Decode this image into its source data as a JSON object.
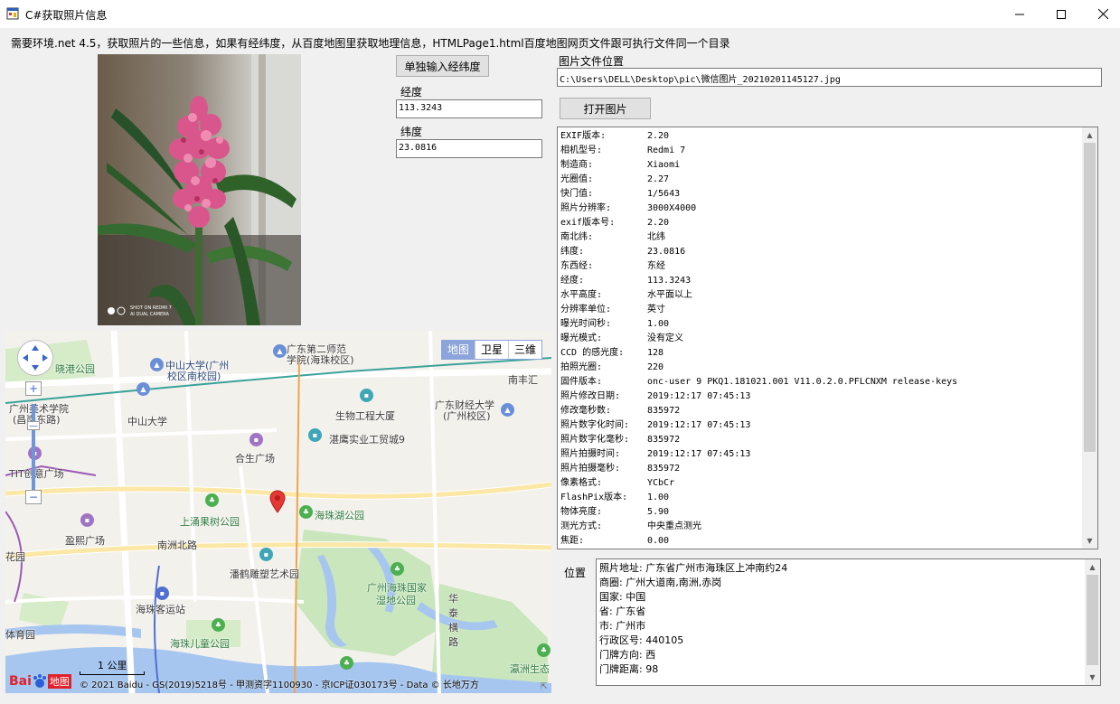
{
  "window": {
    "title": "C#获取照片信息",
    "minimize_label": "—",
    "maximize_label": "☐",
    "close_label": "✕"
  },
  "requirement_text": "需要环境.net 4.5，获取照片的一些信息，如果有经纬度，从百度地图里获取地理信息，HTMLPage1.html百度地图网页文件跟可执行文件同一个目录",
  "photo": {
    "watermark_line1": "SHOT ON REDMI 7",
    "watermark_line2": "AI DUAL CAMERA"
  },
  "manual_input_button": "单独输入经纬度",
  "longitude_label": "经度",
  "longitude_value": "113.3243",
  "latitude_label": "纬度",
  "latitude_value": "23.0816",
  "path_label": "图片文件位置",
  "path_value": "C:\\Users\\DELL\\Desktop\\pic\\微信图片_20210201145127.jpg",
  "open_button": "打开图片",
  "exif": [
    {
      "key": "EXIF版本:",
      "value": "2.20"
    },
    {
      "key": "相机型号:",
      "value": "Redmi 7"
    },
    {
      "key": "制造商:",
      "value": "Xiaomi"
    },
    {
      "key": "光圈值:",
      "value": "2.27"
    },
    {
      "key": "快门值:",
      "value": "1/5643"
    },
    {
      "key": "照片分辨率:",
      "value": "3000X4000"
    },
    {
      "key": "exif版本号:",
      "value": "2.20"
    },
    {
      "key": "南北纬:",
      "value": "北纬"
    },
    {
      "key": "纬度:",
      "value": "23.0816"
    },
    {
      "key": "东西经:",
      "value": "东经"
    },
    {
      "key": "经度:",
      "value": "113.3243"
    },
    {
      "key": "水平高度:",
      "value": "水平面以上"
    },
    {
      "key": "分辨率单位:",
      "value": "英寸"
    },
    {
      "key": "曝光时间秒:",
      "value": "1.00"
    },
    {
      "key": "曝光模式:",
      "value": "没有定义"
    },
    {
      "key": "CCD 的感光度:",
      "value": "128"
    },
    {
      "key": "拍照光圈:",
      "value": "220"
    },
    {
      "key": "固件版本:",
      "value": "onc-user 9 PKQ1.181021.001 V11.0.2.0.PFLCNXM release-keys"
    },
    {
      "key": "照片修改日期:",
      "value": "2019:12:17 07:45:13"
    },
    {
      "key": "修改毫秒数:",
      "value": "835972"
    },
    {
      "key": "照片数字化时间:",
      "value": "2019:12:17 07:45:13"
    },
    {
      "key": "照片数字化毫秒:",
      "value": "835972"
    },
    {
      "key": "照片拍摄时间:",
      "value": "2019:12:17 07:45:13"
    },
    {
      "key": "照片拍摄毫秒:",
      "value": "835972"
    },
    {
      "key": "像素格式:",
      "value": "YCbCr"
    },
    {
      "key": "FlashPix版本:",
      "value": "1.00"
    },
    {
      "key": "物体亮度:",
      "value": "5.90"
    },
    {
      "key": "测光方式:",
      "value": "中央重点测光"
    },
    {
      "key": "焦距:",
      "value": "0.00"
    }
  ],
  "location_label": "位置",
  "location": [
    "照片地址: 广东省广州市海珠区上冲南约24",
    "商圈: 广州大道南,南洲,赤岗",
    "国家: 中国",
    "省: 广东省",
    "市: 广州市",
    "行政区号: 440105",
    "门牌方向: 西",
    "门牌距离: 98"
  ],
  "map": {
    "type_buttons": [
      "地图",
      "卫星",
      "三维"
    ],
    "pois": [
      {
        "name": "广东第二师范",
        "cls": "poi"
      },
      {
        "name": "学院(海珠校区)",
        "cls": "poi"
      },
      {
        "name": "中山大学(广州",
        "cls": "poi poi-blue"
      },
      {
        "name": "校区南校园)",
        "cls": "poi poi-blue"
      },
      {
        "name": "晓港公园",
        "cls": "poi poi-green"
      },
      {
        "name": "广州美术学院",
        "cls": "poi"
      },
      {
        "name": "(昌岗东路)",
        "cls": "poi"
      },
      {
        "name": "中山大学",
        "cls": "poi"
      },
      {
        "name": "生物工程大厦",
        "cls": "poi"
      },
      {
        "name": "广东财经大学",
        "cls": "poi"
      },
      {
        "name": "(广州校区)",
        "cls": "poi"
      },
      {
        "name": "湛鹰实业工贸城9",
        "cls": "poi"
      },
      {
        "name": "TIT创意广场",
        "cls": "poi"
      },
      {
        "name": "合生广场",
        "cls": "poi"
      },
      {
        "name": "南丰汇",
        "cls": "poi"
      },
      {
        "name": "上涌果树公园",
        "cls": "poi poi-green"
      },
      {
        "name": "海珠湖公园",
        "cls": "poi poi-green"
      },
      {
        "name": "盈熙广场",
        "cls": "poi"
      },
      {
        "name": "南洲北路",
        "cls": "poi"
      },
      {
        "name": "潘鹤雕塑艺术园",
        "cls": "poi"
      },
      {
        "name": "广州海珠国家",
        "cls": "poi poi-green"
      },
      {
        "name": "湿地公园",
        "cls": "poi poi-green"
      },
      {
        "name": "华",
        "cls": "poi"
      },
      {
        "name": "泰",
        "cls": "poi"
      },
      {
        "name": "横",
        "cls": "poi"
      },
      {
        "name": "路",
        "cls": "poi"
      },
      {
        "name": "海珠客运站",
        "cls": "poi"
      },
      {
        "name": "花园",
        "cls": "poi"
      },
      {
        "name": "体育园",
        "cls": "poi"
      },
      {
        "name": "海珠儿童公园",
        "cls": "poi poi-green"
      },
      {
        "name": "瀛洲生态",
        "cls": "poi poi-green"
      }
    ],
    "scale_label": "1 公里",
    "baidu_logo": "Bai",
    "baidu_logo_suffix": "地图",
    "copyright": "© 2021 Baidu - GS(2019)5218号 - 甲测资字1100930 - 京ICP证030173号 - Data © 长地万方"
  },
  "colors": {
    "window_bg": "#f0f0f0",
    "button_bg": "#e1e1e1",
    "map_road": "#ffffff",
    "map_river": "#a6c6ef",
    "map_park": "#c9e6bd",
    "map_pin": "#e53935",
    "map_type_active": "#8ba4d9"
  }
}
